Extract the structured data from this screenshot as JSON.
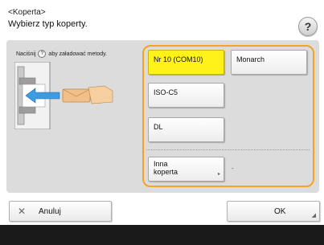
{
  "header": {
    "section": "<Koperta>",
    "title": "Wybierz typ koperty.",
    "help": "?"
  },
  "instruction": {
    "before": "Naciśnij",
    "icon": "?",
    "after": "aby załadować metody."
  },
  "illustration": {
    "icon": "envelope-feed-icon"
  },
  "options": [
    {
      "label": "Nr 10 (COM10)",
      "selected": true
    },
    {
      "label": "Monarch"
    },
    {
      "label": "ISO-C5"
    },
    {
      "label": "DL"
    },
    {
      "label_line1": "Inna",
      "label_line2": "koperta"
    }
  ],
  "other_value": "-",
  "buttons": {
    "cancel": "Anuluj",
    "ok": "OK"
  },
  "colors": {
    "selected": "#fff21a",
    "highlight_border": "#f4a322",
    "panel": "#dcdcdc"
  }
}
